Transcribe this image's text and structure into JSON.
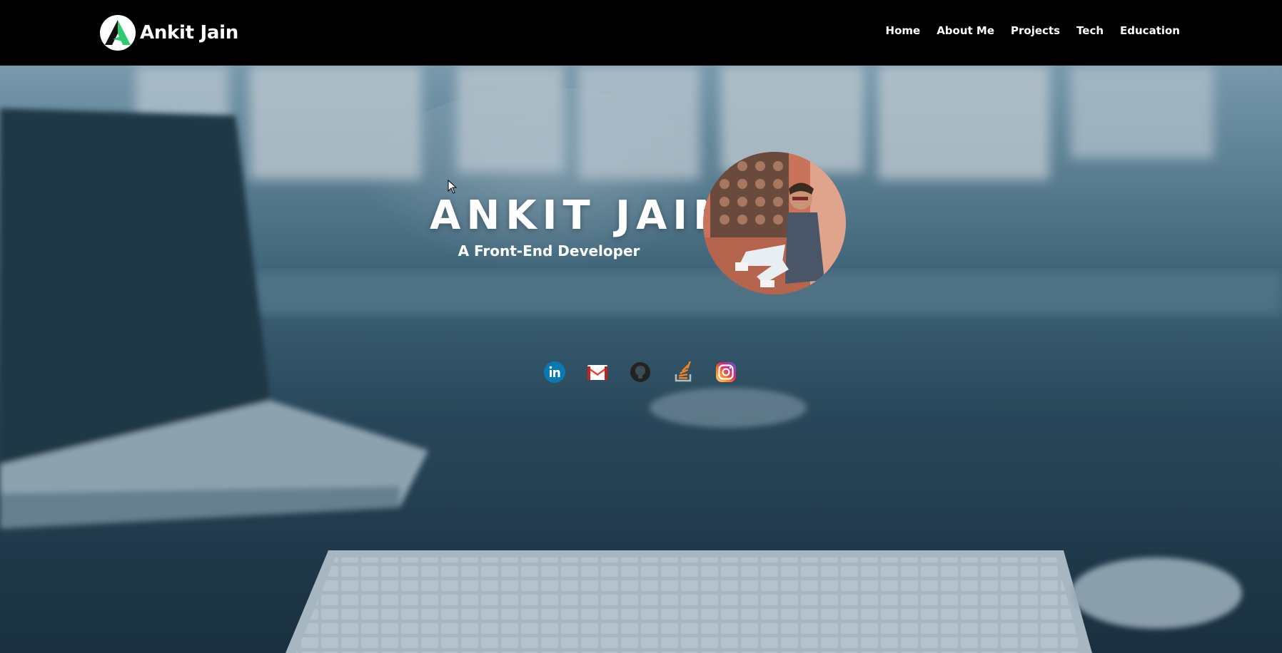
{
  "header": {
    "brand_name": "Ankit Jain",
    "nav": [
      {
        "label": "Home"
      },
      {
        "label": "About Me"
      },
      {
        "label": "Projects"
      },
      {
        "label": "Tech"
      },
      {
        "label": "Education"
      }
    ]
  },
  "hero": {
    "title": "ANKIT JAIN",
    "subtitle": "A Front-End Developer"
  },
  "socials": [
    {
      "icon": "linkedin-icon",
      "color": "#0a78b5"
    },
    {
      "icon": "gmail-icon",
      "color": "#ea4335"
    },
    {
      "icon": "github-icon",
      "color": "#333333"
    },
    {
      "icon": "stackoverflow-icon",
      "color": "#f48024"
    },
    {
      "icon": "instagram-icon",
      "color": "#c13584"
    }
  ],
  "colors": {
    "navbar_bg": "#000000",
    "logo_accent": "#2ecc71",
    "hero_tint": "#2f5366"
  }
}
